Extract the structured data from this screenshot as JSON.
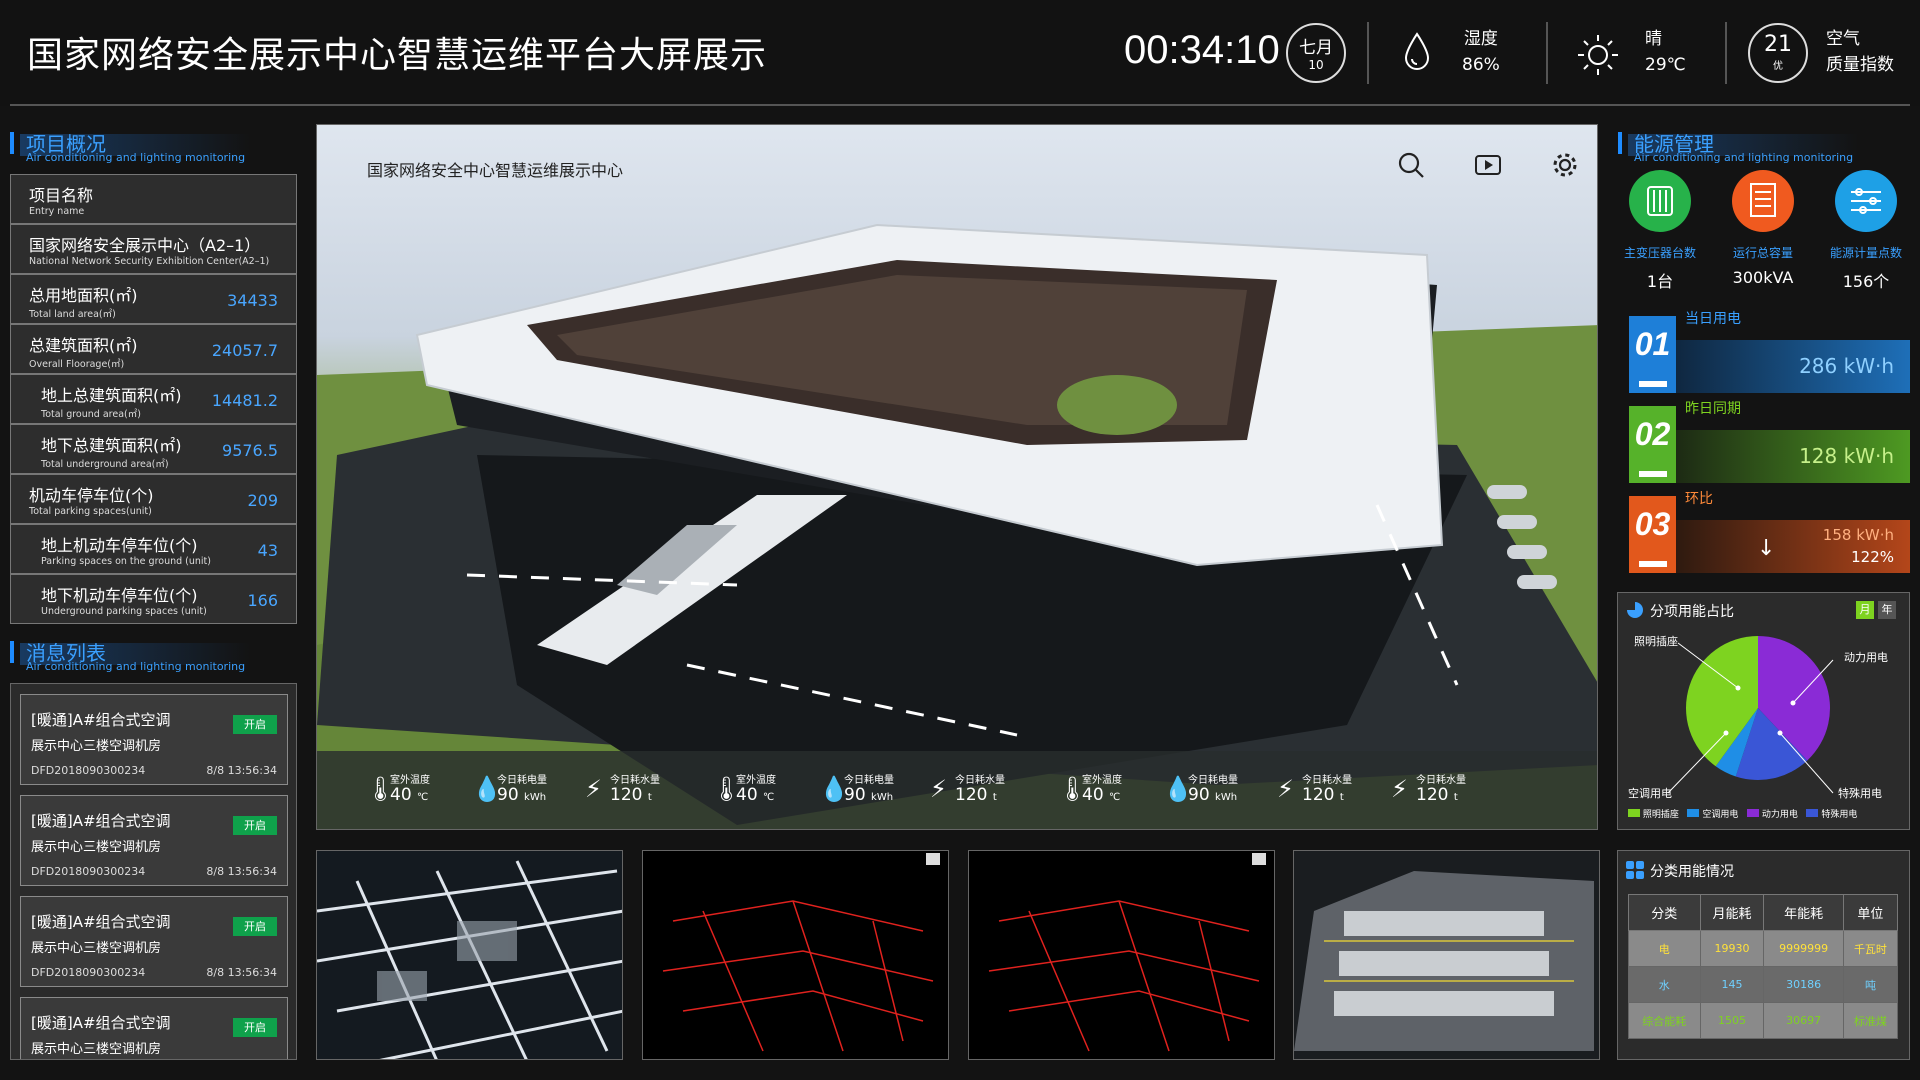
{
  "header": {
    "title": "国家网络安全展示中心智慧运维平台大屏展示",
    "clock": "00:34:10",
    "month": "七月",
    "day": "10",
    "humidity_label": "湿度",
    "humidity_value": "86%",
    "weather_label": "晴",
    "temperature": "29℃",
    "aqi_value": "21",
    "aqi_quality": "优",
    "aqi_label1": "空气",
    "aqi_label2": "质量指数"
  },
  "project": {
    "title": "项目概况",
    "subtitle": "Air conditioning and lighting monitoring",
    "rows": [
      {
        "zh": "项目名称",
        "en": "Entry name",
        "value": ""
      },
      {
        "zh": "国家网络安全展示中心（A2–1）",
        "en": "National Network Security Exhibition Center(A2–1)",
        "value": ""
      },
      {
        "zh": "总用地面积(㎡)",
        "en": "Total land area(㎡)",
        "value": "34433"
      },
      {
        "zh": "总建筑面积(㎡)",
        "en": "Overall Floorage(㎡)",
        "value": "24057.7"
      },
      {
        "zh": "地上总建筑面积(㎡)",
        "en": "Total ground area(㎡)",
        "value": "14481.2"
      },
      {
        "zh": "地下总建筑面积(㎡)",
        "en": "Total underground area(㎡)",
        "value": "9576.5"
      },
      {
        "zh": "机动车停车位(个)",
        "en": "Total parking spaces(unit)",
        "value": "209"
      },
      {
        "zh": "地上机动车停车位(个)",
        "en": "Parking spaces on the ground (unit)",
        "value": "43"
      },
      {
        "zh": "地下机动车停车位(个)",
        "en": "Underground parking spaces (unit)",
        "value": "166"
      }
    ]
  },
  "messages": {
    "title": "消息列表",
    "subtitle": "Air conditioning and lighting monitoring",
    "items": [
      {
        "title": "[暖通]A#组合式空调",
        "location": "展示中心三楼空调机房",
        "id": "DFD2018090300234",
        "time": "8/8 13:56:34",
        "tag": "开启"
      },
      {
        "title": "[暖通]A#组合式空调",
        "location": "展示中心三楼空调机房",
        "id": "DFD2018090300234",
        "time": "8/8 13:56:34",
        "tag": "开启"
      },
      {
        "title": "[暖通]A#组合式空调",
        "location": "展示中心三楼空调机房",
        "id": "DFD2018090300234",
        "time": "8/8 13:56:34",
        "tag": "开启"
      },
      {
        "title": "[暖通]A#组合式空调",
        "location": "展示中心三楼空调机房",
        "id": "",
        "time": "",
        "tag": "开启"
      }
    ]
  },
  "scene": {
    "title": "国家网络安全中心智慧运维展示中心",
    "metrics": [
      {
        "label": "室外温度",
        "value": "40",
        "unit": "℃",
        "icon": "thermometer-icon"
      },
      {
        "label": "今日耗电量",
        "value": "90",
        "unit": "kWh",
        "icon": "drop-icon"
      },
      {
        "label": "今日耗水量",
        "value": "120",
        "unit": "t",
        "icon": "bolt-icon"
      },
      {
        "label": "室外温度",
        "value": "40",
        "unit": "℃",
        "icon": "thermometer-icon"
      },
      {
        "label": "今日耗电量",
        "value": "90",
        "unit": "kWh",
        "icon": "drop-icon"
      },
      {
        "label": "今日耗水量",
        "value": "120",
        "unit": "t",
        "icon": "bolt-icon"
      },
      {
        "label": "室外温度",
        "value": "40",
        "unit": "℃",
        "icon": "thermometer-icon"
      },
      {
        "label": "今日耗电量",
        "value": "90",
        "unit": "kWh",
        "icon": "drop-icon"
      },
      {
        "label": "今日耗水量",
        "value": "120",
        "unit": "t",
        "icon": "bolt-icon"
      },
      {
        "label": "今日耗水量",
        "value": "120",
        "unit": "t",
        "icon": "bolt-icon"
      }
    ]
  },
  "energy": {
    "title": "能源管理",
    "subtitle": "Air conditioning and lighting monitoring",
    "icons": [
      {
        "label": "主变压器台数",
        "value": "1台",
        "color": "#27b24a",
        "icon": "transformer-icon"
      },
      {
        "label": "运行总容量",
        "value": "300kVA",
        "color": "#f05a1f",
        "icon": "capacity-icon"
      },
      {
        "label": "能源计量点数",
        "value": "156个",
        "color": "#1ea0e6",
        "icon": "meter-icon"
      }
    ],
    "cards": [
      {
        "num": "01",
        "label": "当日用电",
        "value": "286 kW·h",
        "color": "#1e7fd8"
      },
      {
        "num": "02",
        "label": "昨日同期",
        "value": "128 kW·h",
        "color": "#56b22a"
      },
      {
        "num": "03",
        "label": "环比",
        "value": "158 kW·h",
        "pct": "122%",
        "color": "#e2581c"
      }
    ]
  },
  "pie": {
    "title": "分项用能占比",
    "btn_month": "月",
    "btn_year": "年",
    "chart_data": {
      "type": "pie",
      "categories": [
        "照明插座",
        "空调用电",
        "动力用电",
        "特殊用电"
      ],
      "values": [
        40,
        5,
        38,
        17
      ],
      "colors": [
        "#7ed320",
        "#1f8ee6",
        "#8a2bd6",
        "#3a56d6"
      ]
    },
    "callouts": [
      "照明插座",
      "动力用电",
      "空调用电",
      "特殊用电"
    ]
  },
  "table": {
    "title": "分类用能情况",
    "headers": [
      "分类",
      "月能耗",
      "年能耗",
      "单位"
    ],
    "rows": [
      [
        "电",
        "19930",
        "9999999",
        "千瓦时"
      ],
      [
        "水",
        "145",
        "30186",
        "吨"
      ],
      [
        "综合能耗",
        "1505",
        "30697",
        "标准煤"
      ]
    ]
  }
}
